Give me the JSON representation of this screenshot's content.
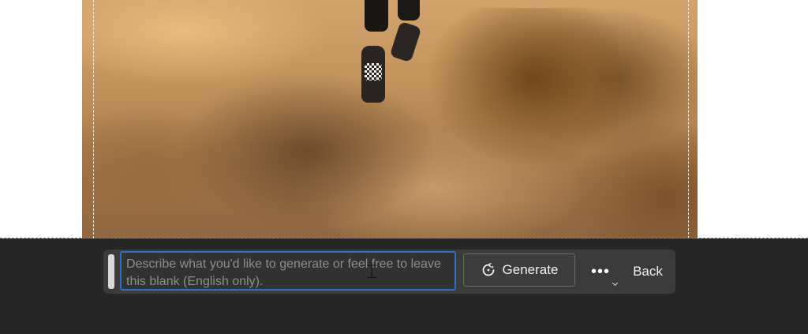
{
  "prompt": {
    "placeholder": "Describe what you'd like to generate or feel free to leave this blank (English only).",
    "value": ""
  },
  "actions": {
    "generate_label": "Generate",
    "generate_icon": "sparkle-refresh-icon",
    "more_label": "•••",
    "back_label": "Back"
  },
  "colors": {
    "panel_bg": "#262626",
    "bar_bg": "#3b3b3b",
    "focus_border": "#2f6fc1"
  }
}
